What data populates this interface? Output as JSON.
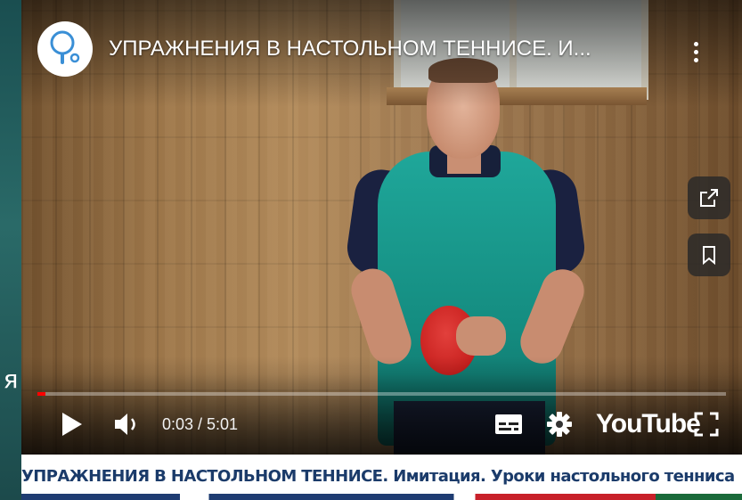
{
  "slide": {
    "partial_text": "я"
  },
  "video": {
    "title": "УПРАЖНЕНИЯ В НАСТОЛЬНОМ ТЕННИСЕ. И...",
    "channel_icon": "ping-pong-paddle-icon",
    "progress_fraction": 0.011,
    "time": "0:03 / 5:01",
    "logo_text": "YouTube"
  },
  "side_actions": [
    {
      "icon": "share-icon"
    },
    {
      "icon": "bookmark-icon"
    }
  ],
  "controls": {
    "play_icon": "play-icon",
    "volume_icon": "volume-icon",
    "captions_icon": "subtitles-icon",
    "settings_icon": "gear-icon",
    "fullscreen_icon": "fullscreen-icon"
  },
  "caption": {
    "text": "УПРАЖНЕНИЯ В НАСТОЛЬНОМ ТЕННИСЕ. Имитация. Уроки настольного тенниса"
  },
  "colors": {
    "progress": "#ff0000",
    "caption_text": "#1b3b6a",
    "slide_background": "#1e4a4a"
  }
}
